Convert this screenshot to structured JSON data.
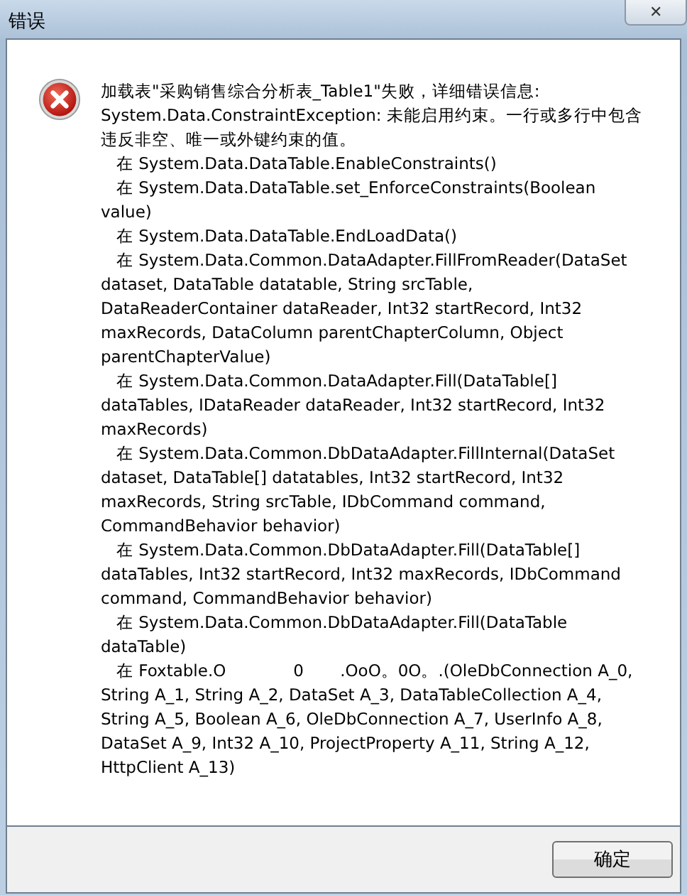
{
  "window": {
    "title": "错误",
    "close": "✕"
  },
  "message_lines": [
    "加载表\"采购销售综合分析表_Table1\"失败，详细错误信息:",
    "System.Data.ConstraintException: 未能启用约束。一行或多行中包含",
    "违反非空、唯一或外键约束的值。",
    "   在 System.Data.DataTable.EnableConstraints()",
    "   在 System.Data.DataTable.set_EnforceConstraints(Boolean",
    "value)",
    "   在 System.Data.DataTable.EndLoadData()",
    "   在 System.Data.Common.DataAdapter.FillFromReader(DataSet",
    "dataset, DataTable datatable, String srcTable,",
    "DataReaderContainer dataReader, Int32 startRecord, Int32",
    "maxRecords, DataColumn parentChapterColumn, Object",
    "parentChapterValue)",
    "   在 System.Data.Common.DataAdapter.Fill(DataTable[]",
    "dataTables, IDataReader dataReader, Int32 startRecord, Int32",
    "maxRecords)",
    "   在 System.Data.Common.DbDataAdapter.FillInternal(DataSet",
    "dataset, DataTable[] datatables, Int32 startRecord, Int32",
    "maxRecords, String srcTable, IDbCommand command,",
    "CommandBehavior behavior)",
    "   在 System.Data.Common.DbDataAdapter.Fill(DataTable[]",
    "dataTables, Int32 startRecord, Int32 maxRecords, IDbCommand",
    "command, CommandBehavior behavior)",
    "   在 System.Data.Common.DbDataAdapter.Fill(DataTable",
    "dataTable)",
    "   在 Foxtable.O             0       .OoO。0O。.(OleDbConnection A_0,",
    "String A_1, String A_2, DataSet A_3, DataTableCollection A_4,",
    "String A_5, Boolean A_6, OleDbConnection A_7, UserInfo A_8,",
    "DataSet A_9, Int32 A_10, ProjectProperty A_11, String A_12,",
    "HttpClient A_13)"
  ],
  "buttons": [
    {
      "label": "确定"
    }
  ]
}
